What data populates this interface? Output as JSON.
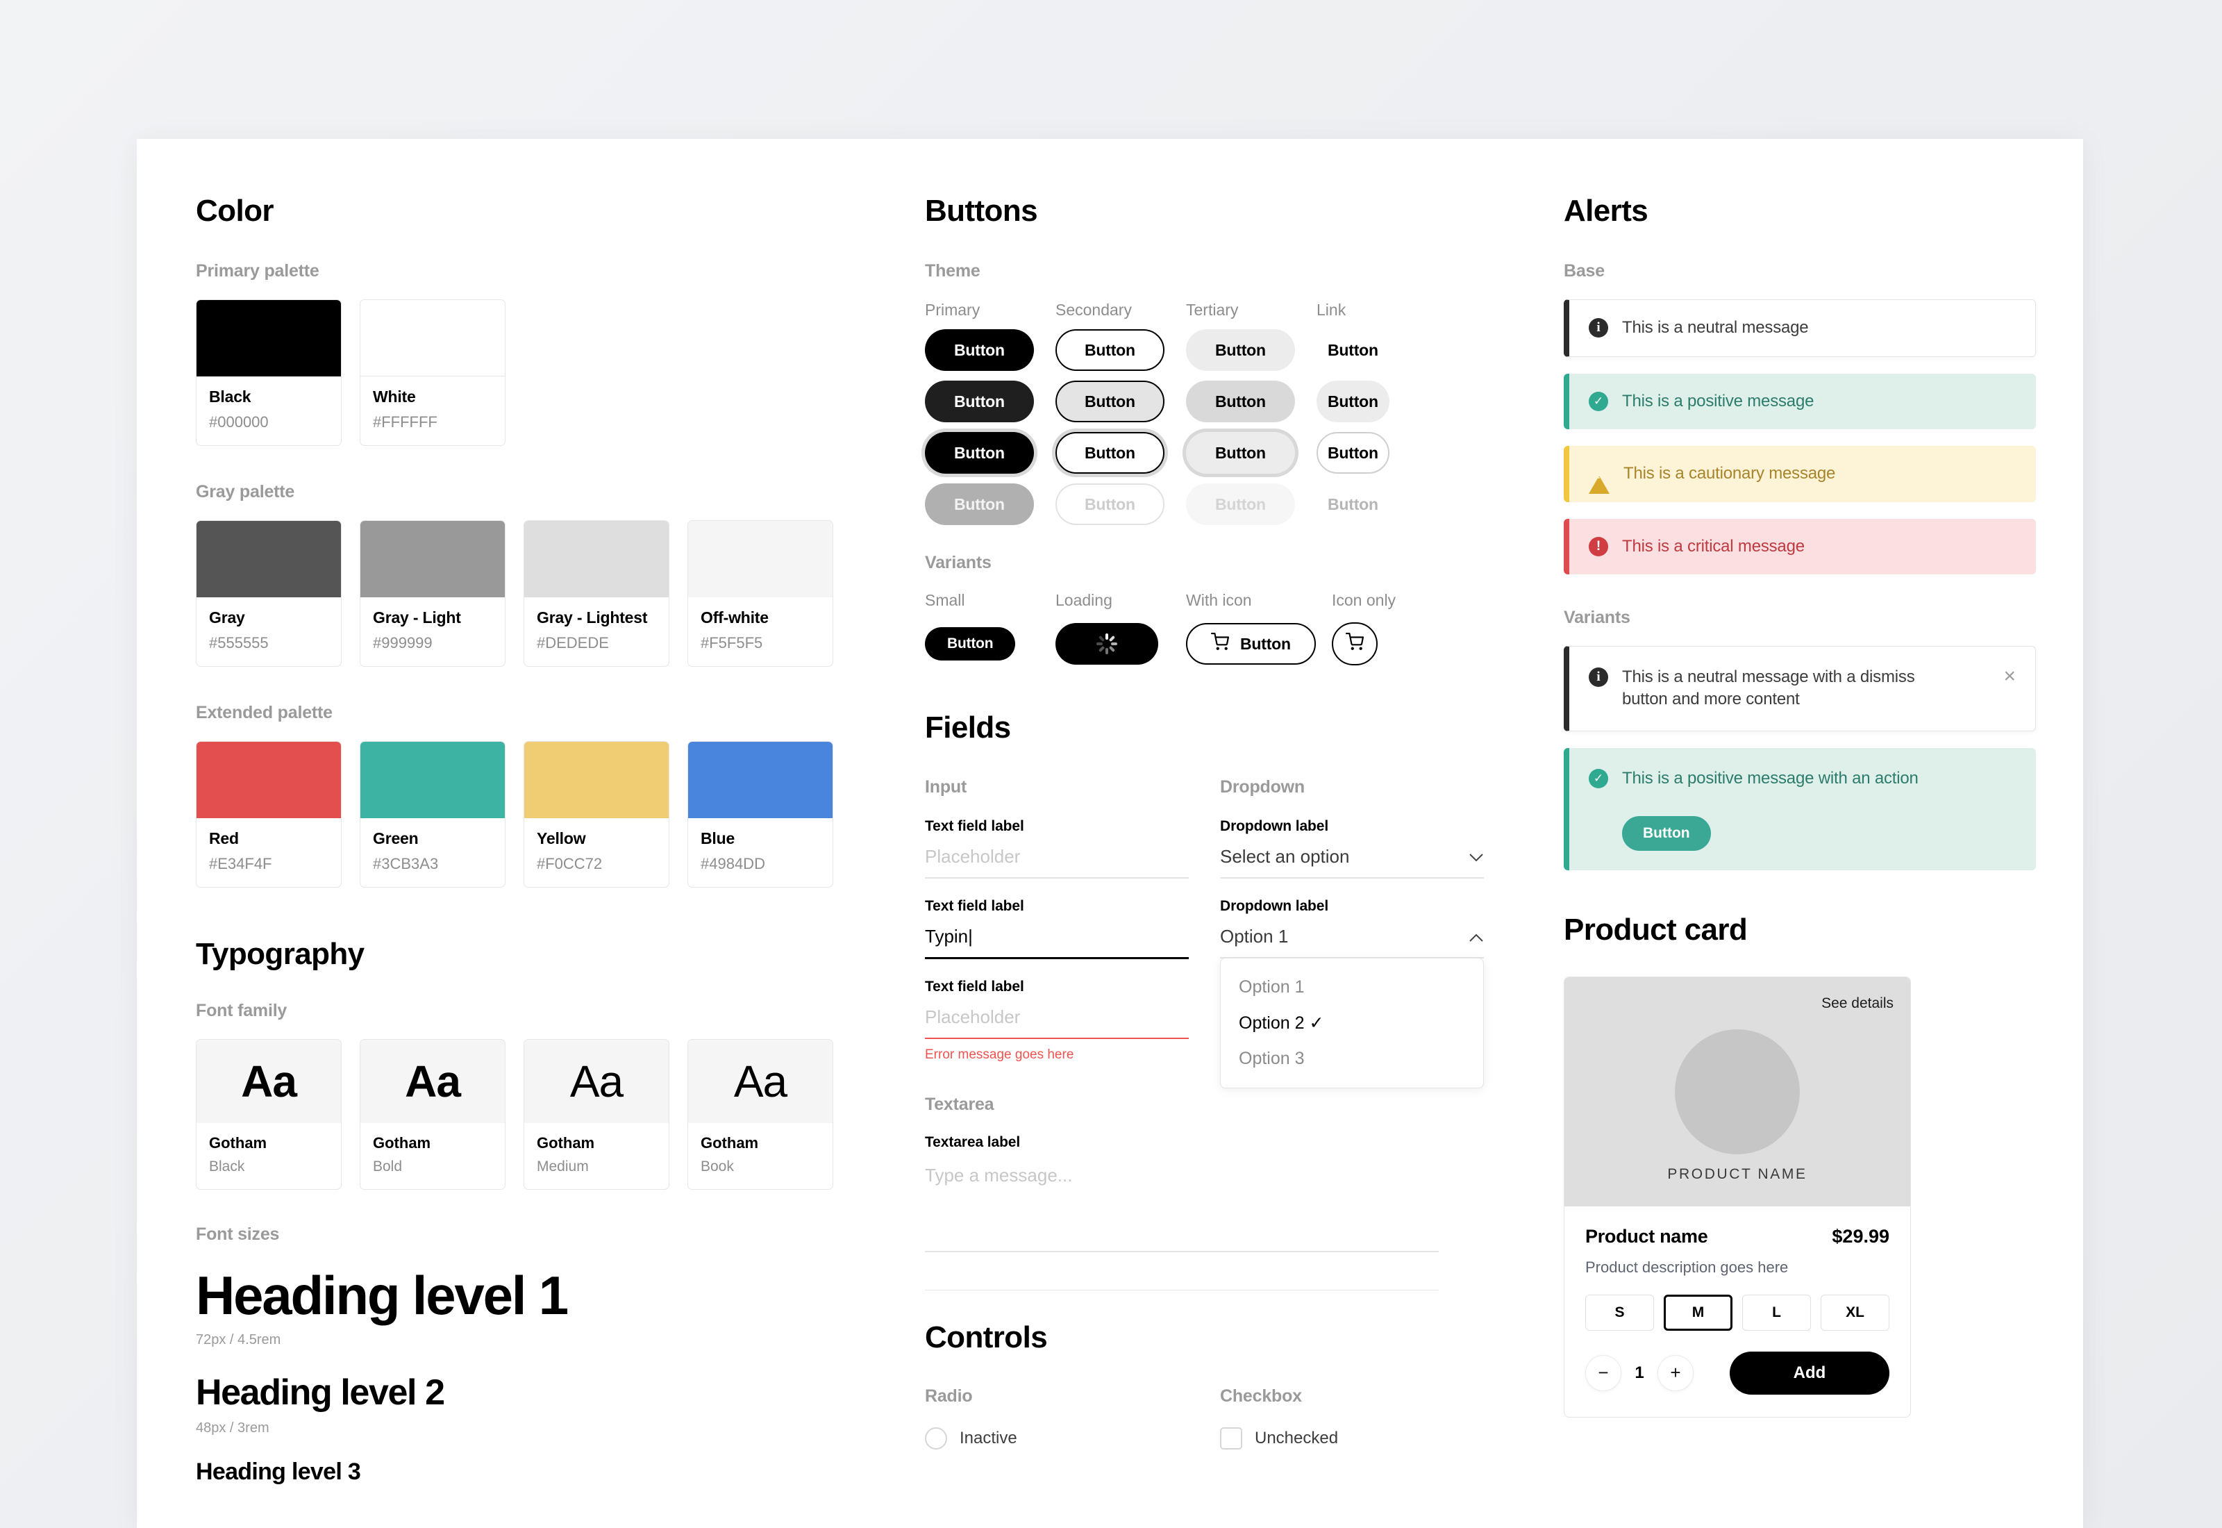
{
  "color": {
    "title": "Color",
    "primary_label": "Primary palette",
    "gray_label": "Gray palette",
    "extended_label": "Extended palette",
    "primary": [
      {
        "name": "Black",
        "hex": "#000000"
      },
      {
        "name": "White",
        "hex": "#FFFFFF"
      }
    ],
    "gray": [
      {
        "name": "Gray",
        "hex": "#555555"
      },
      {
        "name": "Gray - Light",
        "hex": "#999999"
      },
      {
        "name": "Gray - Lightest",
        "hex": "#DEDEDE"
      },
      {
        "name": "Off-white",
        "hex": "#F5F5F5"
      }
    ],
    "extended": [
      {
        "name": "Red",
        "hex": "#E34F4F"
      },
      {
        "name": "Green",
        "hex": "#3CB3A3"
      },
      {
        "name": "Yellow",
        "hex": "#F0CC72"
      },
      {
        "name": "Blue",
        "hex": "#4984DD"
      }
    ]
  },
  "typography": {
    "title": "Typography",
    "family_label": "Font family",
    "sizes_label": "Font sizes",
    "sample_glyph": "Aa",
    "families": [
      {
        "name": "Gotham",
        "weight": "Black"
      },
      {
        "name": "Gotham",
        "weight": "Bold"
      },
      {
        "name": "Gotham",
        "weight": "Medium"
      },
      {
        "name": "Gotham",
        "weight": "Book"
      }
    ],
    "sizes": [
      {
        "text": "Heading level 1",
        "note": "72px / 4.5rem"
      },
      {
        "text": "Heading level 2",
        "note": "48px / 3rem"
      },
      {
        "text": "Heading level 3",
        "note": ""
      }
    ]
  },
  "buttons": {
    "title": "Buttons",
    "theme_label": "Theme",
    "variants_label": "Variants",
    "themes": [
      "Primary",
      "Secondary",
      "Tertiary",
      "Link"
    ],
    "label": "Button",
    "states": [
      "default",
      "hover",
      "focus",
      "disabled"
    ],
    "variants": {
      "headers": [
        "Small",
        "Loading",
        "With icon",
        "Icon only"
      ],
      "small_label": "Button",
      "with_icon_label": "Button",
      "cart_icon": "cart-icon",
      "loading_icon": "spinner-icon"
    }
  },
  "fields": {
    "title": "Fields",
    "input_label": "Input",
    "dropdown_label": "Dropdown",
    "textarea_label": "Textarea",
    "inputs": [
      {
        "label": "Text field label",
        "value": "",
        "placeholder": "Placeholder",
        "state": "default",
        "error": ""
      },
      {
        "label": "Text field label",
        "value": "Typin",
        "placeholder": "",
        "state": "active",
        "error": ""
      },
      {
        "label": "Text field label",
        "value": "",
        "placeholder": "Placeholder",
        "state": "error",
        "error": "Error message goes here"
      }
    ],
    "dropdowns": [
      {
        "label": "Dropdown label",
        "value": "Select an option",
        "open": false,
        "chevron": "chevron-down-icon"
      },
      {
        "label": "Dropdown label",
        "value": "Option 1",
        "open": true,
        "chevron": "chevron-up-icon"
      }
    ],
    "dropdown_options": [
      "Option 1",
      "Option 2",
      "Option 3"
    ],
    "dropdown_selected": "Option 2",
    "textarea": {
      "label": "Textarea label",
      "placeholder": "Type a message...",
      "value": ""
    }
  },
  "controls": {
    "title": "Controls",
    "radio_label": "Radio",
    "checkbox_label": "Checkbox",
    "radio_option": "Inactive",
    "checkbox_option": "Unchecked"
  },
  "alerts": {
    "title": "Alerts",
    "base_label": "Base",
    "variants_label": "Variants",
    "base": [
      {
        "type": "neutral",
        "icon": "info-icon",
        "text": "This is a neutral message"
      },
      {
        "type": "positive",
        "icon": "check-icon",
        "text": "This is a positive message"
      },
      {
        "type": "caution",
        "icon": "warning-icon",
        "text": "This is a cautionary message"
      },
      {
        "type": "critical",
        "icon": "error-icon",
        "text": "This is a critical message"
      }
    ],
    "variants": [
      {
        "type": "neutral",
        "icon": "info-icon",
        "text": "This is a neutral message with a dismiss button and more content",
        "dismiss": "close-icon"
      },
      {
        "type": "positive",
        "icon": "check-icon",
        "text": "This is a positive message with an action",
        "action_label": "Button"
      }
    ]
  },
  "product_card": {
    "title": "Product card",
    "see_details": "See details",
    "image_caption": "PRODUCT NAME",
    "name": "Product name",
    "price": "$29.99",
    "description": "Product description goes here",
    "sizes": [
      "S",
      "M",
      "L",
      "XL"
    ],
    "selected_size": "M",
    "quantity": "1",
    "decrement": "−",
    "increment": "+",
    "add_label": "Add"
  }
}
